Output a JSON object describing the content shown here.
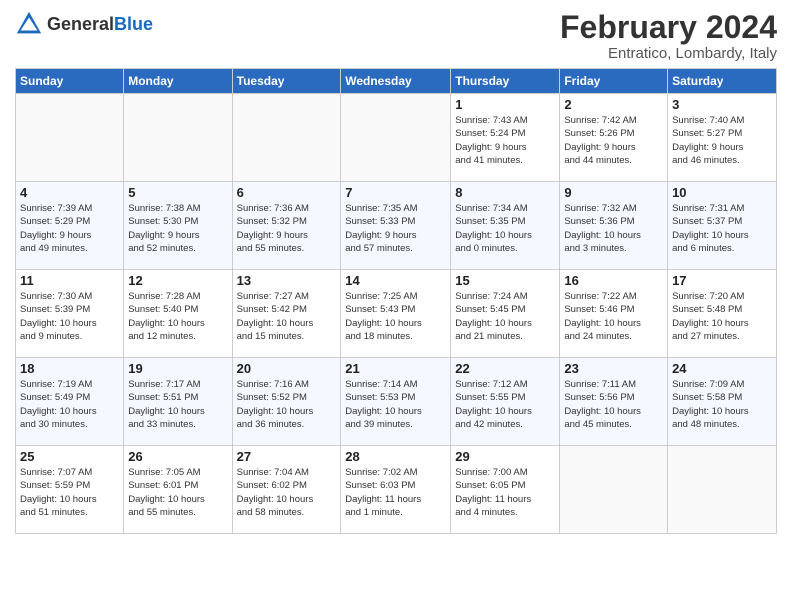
{
  "logo": {
    "general": "General",
    "blue": "Blue"
  },
  "header": {
    "title": "February 2024",
    "subtitle": "Entratico, Lombardy, Italy"
  },
  "weekdays": [
    "Sunday",
    "Monday",
    "Tuesday",
    "Wednesday",
    "Thursday",
    "Friday",
    "Saturday"
  ],
  "weeks": [
    [
      {
        "day": "",
        "info": ""
      },
      {
        "day": "",
        "info": ""
      },
      {
        "day": "",
        "info": ""
      },
      {
        "day": "",
        "info": ""
      },
      {
        "day": "1",
        "info": "Sunrise: 7:43 AM\nSunset: 5:24 PM\nDaylight: 9 hours\nand 41 minutes."
      },
      {
        "day": "2",
        "info": "Sunrise: 7:42 AM\nSunset: 5:26 PM\nDaylight: 9 hours\nand 44 minutes."
      },
      {
        "day": "3",
        "info": "Sunrise: 7:40 AM\nSunset: 5:27 PM\nDaylight: 9 hours\nand 46 minutes."
      }
    ],
    [
      {
        "day": "4",
        "info": "Sunrise: 7:39 AM\nSunset: 5:29 PM\nDaylight: 9 hours\nand 49 minutes."
      },
      {
        "day": "5",
        "info": "Sunrise: 7:38 AM\nSunset: 5:30 PM\nDaylight: 9 hours\nand 52 minutes."
      },
      {
        "day": "6",
        "info": "Sunrise: 7:36 AM\nSunset: 5:32 PM\nDaylight: 9 hours\nand 55 minutes."
      },
      {
        "day": "7",
        "info": "Sunrise: 7:35 AM\nSunset: 5:33 PM\nDaylight: 9 hours\nand 57 minutes."
      },
      {
        "day": "8",
        "info": "Sunrise: 7:34 AM\nSunset: 5:35 PM\nDaylight: 10 hours\nand 0 minutes."
      },
      {
        "day": "9",
        "info": "Sunrise: 7:32 AM\nSunset: 5:36 PM\nDaylight: 10 hours\nand 3 minutes."
      },
      {
        "day": "10",
        "info": "Sunrise: 7:31 AM\nSunset: 5:37 PM\nDaylight: 10 hours\nand 6 minutes."
      }
    ],
    [
      {
        "day": "11",
        "info": "Sunrise: 7:30 AM\nSunset: 5:39 PM\nDaylight: 10 hours\nand 9 minutes."
      },
      {
        "day": "12",
        "info": "Sunrise: 7:28 AM\nSunset: 5:40 PM\nDaylight: 10 hours\nand 12 minutes."
      },
      {
        "day": "13",
        "info": "Sunrise: 7:27 AM\nSunset: 5:42 PM\nDaylight: 10 hours\nand 15 minutes."
      },
      {
        "day": "14",
        "info": "Sunrise: 7:25 AM\nSunset: 5:43 PM\nDaylight: 10 hours\nand 18 minutes."
      },
      {
        "day": "15",
        "info": "Sunrise: 7:24 AM\nSunset: 5:45 PM\nDaylight: 10 hours\nand 21 minutes."
      },
      {
        "day": "16",
        "info": "Sunrise: 7:22 AM\nSunset: 5:46 PM\nDaylight: 10 hours\nand 24 minutes."
      },
      {
        "day": "17",
        "info": "Sunrise: 7:20 AM\nSunset: 5:48 PM\nDaylight: 10 hours\nand 27 minutes."
      }
    ],
    [
      {
        "day": "18",
        "info": "Sunrise: 7:19 AM\nSunset: 5:49 PM\nDaylight: 10 hours\nand 30 minutes."
      },
      {
        "day": "19",
        "info": "Sunrise: 7:17 AM\nSunset: 5:51 PM\nDaylight: 10 hours\nand 33 minutes."
      },
      {
        "day": "20",
        "info": "Sunrise: 7:16 AM\nSunset: 5:52 PM\nDaylight: 10 hours\nand 36 minutes."
      },
      {
        "day": "21",
        "info": "Sunrise: 7:14 AM\nSunset: 5:53 PM\nDaylight: 10 hours\nand 39 minutes."
      },
      {
        "day": "22",
        "info": "Sunrise: 7:12 AM\nSunset: 5:55 PM\nDaylight: 10 hours\nand 42 minutes."
      },
      {
        "day": "23",
        "info": "Sunrise: 7:11 AM\nSunset: 5:56 PM\nDaylight: 10 hours\nand 45 minutes."
      },
      {
        "day": "24",
        "info": "Sunrise: 7:09 AM\nSunset: 5:58 PM\nDaylight: 10 hours\nand 48 minutes."
      }
    ],
    [
      {
        "day": "25",
        "info": "Sunrise: 7:07 AM\nSunset: 5:59 PM\nDaylight: 10 hours\nand 51 minutes."
      },
      {
        "day": "26",
        "info": "Sunrise: 7:05 AM\nSunset: 6:01 PM\nDaylight: 10 hours\nand 55 minutes."
      },
      {
        "day": "27",
        "info": "Sunrise: 7:04 AM\nSunset: 6:02 PM\nDaylight: 10 hours\nand 58 minutes."
      },
      {
        "day": "28",
        "info": "Sunrise: 7:02 AM\nSunset: 6:03 PM\nDaylight: 11 hours\nand 1 minute."
      },
      {
        "day": "29",
        "info": "Sunrise: 7:00 AM\nSunset: 6:05 PM\nDaylight: 11 hours\nand 4 minutes."
      },
      {
        "day": "",
        "info": ""
      },
      {
        "day": "",
        "info": ""
      }
    ]
  ]
}
